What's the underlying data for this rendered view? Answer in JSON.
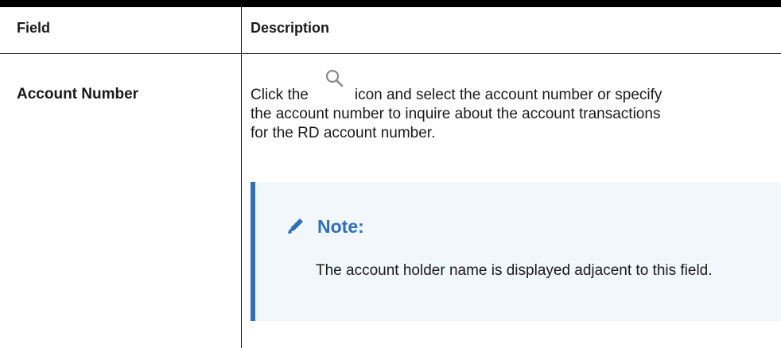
{
  "table": {
    "headers": {
      "field": "Field",
      "description": "Description"
    },
    "rows": [
      {
        "field": "Account Number",
        "description": {
          "line1_before_icon": "Click the",
          "icon": "search-icon",
          "line1_after_icon": "icon and select the account number or specify",
          "line2": "the account number to inquire about the account transactions",
          "line3": "for the RD account number."
        },
        "note": {
          "title": "Note:",
          "icon": "pencil-icon",
          "text": "The account holder name is displayed adjacent to this field."
        }
      }
    ]
  },
  "colors": {
    "accent": "#2f6fb5",
    "note_background": "#f2f7fc",
    "rule": "#000000"
  }
}
